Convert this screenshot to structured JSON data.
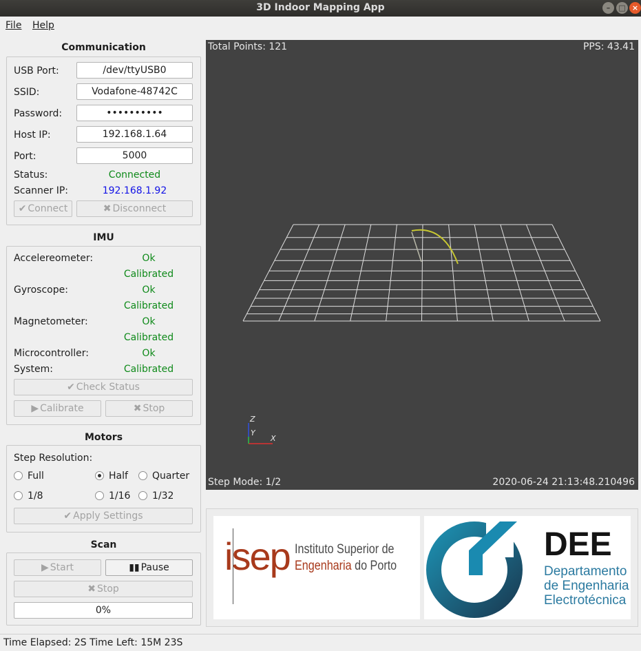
{
  "window": {
    "title": "3D Indoor Mapping App"
  },
  "menu": {
    "file": "File",
    "help": "Help"
  },
  "communication": {
    "title": "Communication",
    "usb_label": "USB Port:",
    "usb_value": "/dev/ttyUSB0",
    "ssid_label": "SSID:",
    "ssid_value": "Vodafone-48742C",
    "password_label": "Password:",
    "password_value": "••••••••••",
    "host_label": "Host IP:",
    "host_value": "192.168.1.64",
    "port_label": "Port:",
    "port_value": "5000",
    "status_label": "Status:",
    "status_value": "Connected",
    "scanner_ip_label": "Scanner IP:",
    "scanner_ip_value": "192.168.1.92",
    "connect_label": "Connect",
    "disconnect_label": "Disconnect"
  },
  "imu": {
    "title": "IMU",
    "accel_label": "Accelereometer:",
    "accel_status": "Ok",
    "accel_cal": "Calibrated",
    "gyro_label": "Gyroscope:",
    "gyro_status": "Ok",
    "gyro_cal": "Calibrated",
    "mag_label": "Magnetometer:",
    "mag_status": "Ok",
    "mag_cal": "Calibrated",
    "mcu_label": "Microcontroller:",
    "mcu_status": "Ok",
    "system_label": "System:",
    "system_cal": "Calibrated",
    "check_status_label": "Check Status",
    "calibrate_label": "Calibrate",
    "stop_label": "Stop"
  },
  "motors": {
    "title": "Motors",
    "step_resolution_label": "Step Resolution:",
    "options": [
      "Full",
      "Half",
      "Quarter",
      "1/8",
      "1/16",
      "1/32"
    ],
    "selected": "Half",
    "apply_label": "Apply Settings"
  },
  "scan": {
    "title": "Scan",
    "start_label": "Start",
    "pause_label": "Pause",
    "stop_label": "Stop",
    "progress_text": "0%",
    "progress_value": 0
  },
  "viewer": {
    "total_points": "Total Points: 121",
    "pps": "PPS: 43.41",
    "step_mode": "Step Mode: 1/2",
    "timestamp": "2020-06-24 21:13:48.210496",
    "axis_z": "Z",
    "axis_y": "Y",
    "axis_x": "X",
    "scan_color": "#c8c832",
    "grid_color": "#e0e0e0"
  },
  "logos": {
    "isep_mark": "isep",
    "isep_line1": "Instituto Superior de",
    "isep_line2_a": "Engenharia",
    "isep_line2_b": " do Porto",
    "dee_mark": "DEE",
    "dee_line1": "Departamento",
    "dee_line2": "de Engenharia",
    "dee_line3": "Electrotécnica"
  },
  "statusbar": {
    "text": "Time Elapsed: 2S Time Left: 15M 23S"
  }
}
